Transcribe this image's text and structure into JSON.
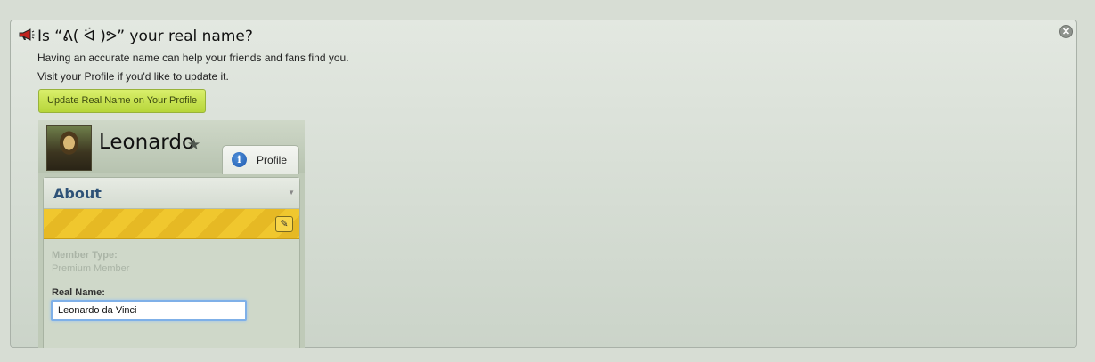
{
  "notice": {
    "title": "Is “ᕕ( ᐛ )ᕗ” your real name?",
    "line1": "Having an accurate name can help your friends and fans find you.",
    "line2": "Visit your Profile if you'd like to update it.",
    "button_label": "Update Real Name on Your Profile",
    "close_glyph": "✕",
    "icons": {
      "megaphone": "megaphone-icon",
      "close": "close-icon"
    }
  },
  "preview": {
    "name": "Leonardo",
    "star_glyph": "★",
    "tab_label": "Profile",
    "info_glyph": "i",
    "about_title": "About",
    "caret_glyph": "▼",
    "edit_glyph": "✎",
    "member_type_label": "Member Type:",
    "member_type_value": "Premium Member",
    "real_name_label": "Real Name:",
    "real_name_value": "Leonardo da Vinci"
  },
  "colors": {
    "background": "#d7ddd4",
    "button_green": "#c6e04e",
    "about_blue": "#2e5277",
    "stripe_yellow": "#f0c72e",
    "input_focus": "#7fb0e8"
  }
}
